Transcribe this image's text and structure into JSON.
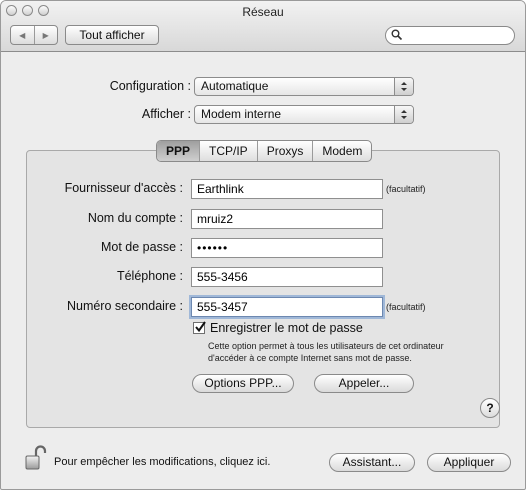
{
  "window": {
    "title": "Réseau"
  },
  "toolbar": {
    "back_glyph": "◀",
    "forward_glyph": "▶",
    "show_all_label": "Tout afficher",
    "search_value": ""
  },
  "top": {
    "configuration_label": "Configuration :",
    "configuration_value": "Automatique",
    "show_label": "Afficher :",
    "show_value": "Modem interne"
  },
  "tabs": [
    {
      "label": "PPP",
      "selected": true
    },
    {
      "label": "TCP/IP",
      "selected": false
    },
    {
      "label": "Proxys",
      "selected": false
    },
    {
      "label": "Modem",
      "selected": false
    }
  ],
  "form": {
    "provider_label": "Fournisseur d'accès :",
    "provider_value": "Earthlink",
    "provider_hint": "(facultatif)",
    "account_label": "Nom du compte :",
    "account_value": "mruiz2",
    "password_label": "Mot de passe :",
    "password_value": "••••••",
    "phone_label": "Téléphone :",
    "phone_value": "555-3456",
    "alt_number_label": "Numéro secondaire :",
    "alt_number_value": "555-3457",
    "alt_number_hint": "(facultatif)",
    "save_password_label": "Enregistrer le mot de passe",
    "save_password_checked": true,
    "save_password_desc_line1": "Cette option permet à tous les utilisateurs de cet ordinateur",
    "save_password_desc_line2": "d'accéder à ce compte Internet sans mot de passe."
  },
  "buttons": {
    "ppp_options": "Options PPP...",
    "dial": "Appeler...",
    "help": "?",
    "assistant": "Assistant...",
    "apply": "Appliquer"
  },
  "footer": {
    "lock_text": "Pour empêcher les modifications, cliquez ici."
  }
}
